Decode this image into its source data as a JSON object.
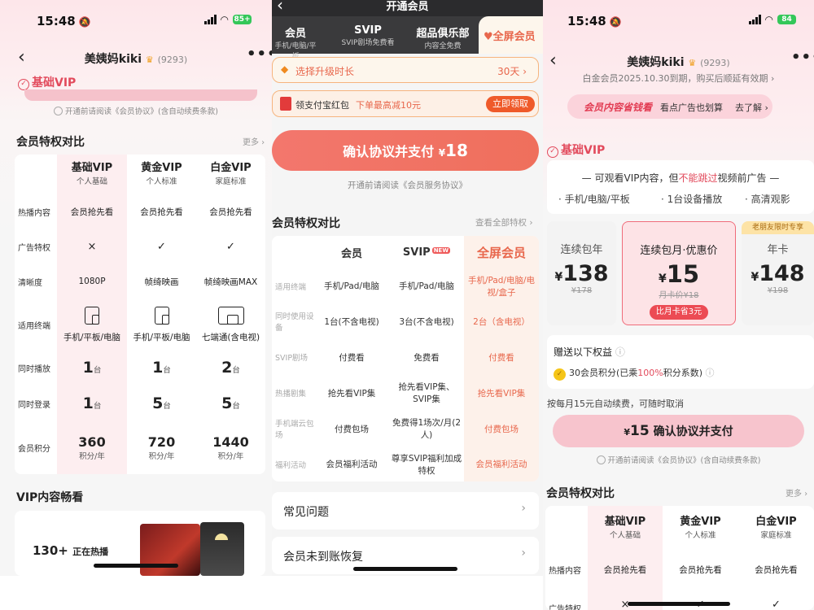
{
  "screen1": {
    "status": {
      "time": "15:48",
      "battery": "85+"
    },
    "header": {
      "title": "美姨妈kiki",
      "count": "(9293)"
    },
    "vip_badge": "基础VIP",
    "agreement": "开通前请阅读《会员协议》(含自动续费条款)",
    "compare": {
      "title": "会员特权对比",
      "more": "更多",
      "columns": [
        {
          "name": "基础VIP",
          "sub": "个人基础"
        },
        {
          "name": "黄金VIP",
          "sub": "个人标准"
        },
        {
          "name": "白金VIP",
          "sub": "家庭标准"
        }
      ],
      "labels": [
        "热播内容",
        "广告特权",
        "清晰度",
        "适用终端",
        "同时播放",
        "同时登录",
        "会员积分"
      ],
      "hot": [
        "会员抢先看",
        "会员抢先看",
        "会员抢先看"
      ],
      "ad": [
        "×",
        "✓",
        "✓"
      ],
      "clarity": [
        "1080P",
        "帧绮映画",
        "帧绮映画MAX"
      ],
      "terminal": [
        "手机/平板/电脑",
        "手机/平板/电脑",
        "七端通(含电视)"
      ],
      "play": [
        {
          "n": "1",
          "u": "台"
        },
        {
          "n": "1",
          "u": "台"
        },
        {
          "n": "2",
          "u": "台"
        }
      ],
      "login": [
        {
          "n": "1",
          "u": "台"
        },
        {
          "n": "5",
          "u": "台"
        },
        {
          "n": "5",
          "u": "台"
        }
      ],
      "points": [
        {
          "n": "360",
          "u": "积分/年"
        },
        {
          "n": "720",
          "u": "积分/年"
        },
        {
          "n": "1440",
          "u": "积分/年"
        }
      ]
    },
    "vip_content": {
      "title": "VIP内容畅看",
      "count": "130+",
      "count_label": "正在热播"
    }
  },
  "screen2": {
    "header_title": "开通会员",
    "tabs": [
      {
        "name": "会员",
        "desc": "手机/电脑/平板"
      },
      {
        "name": "SVIP",
        "desc": "SVIP剧场免费看"
      },
      {
        "name": "超品俱乐部",
        "desc": "内容全免费"
      },
      {
        "name": "全屏会员",
        "desc": ""
      }
    ],
    "duration": {
      "label": "选择升级时长",
      "value": "30天"
    },
    "redpack": {
      "label": "领支付宝红包",
      "highlight": "下单最高减10元",
      "button": "立即领取"
    },
    "pay_button": {
      "label": "确认协议并支付",
      "currency": "¥",
      "amount": "18"
    },
    "agreement": "开通前请阅读《会员服务协议》",
    "compare": {
      "title": "会员特权对比",
      "more": "查看全部特权",
      "columns": [
        "会员",
        "SVIP",
        "全屏会员"
      ],
      "new_badge": "NEW",
      "rows": [
        {
          "label": "适用终端",
          "vals": [
            "手机/Pad/电脑",
            "手机/Pad/电脑",
            "手机/Pad/电脑/电视/盒子"
          ]
        },
        {
          "label": "同时使用设备",
          "vals": [
            "1台(不含电视)",
            "3台(不含电视)",
            "2台（含电视）"
          ]
        },
        {
          "label": "SVIP剧场",
          "vals": [
            "付费看",
            "免费看",
            "付费看"
          ]
        },
        {
          "label": "热播剧集",
          "vals": [
            "抢先看VIP集",
            "抢先看VIP集、SVIP集",
            "抢先看VIP集"
          ]
        },
        {
          "label": "手机端云包场",
          "vals": [
            "付费包场",
            "免费得1场次/月(2人)",
            "付费包场"
          ]
        },
        {
          "label": "福利活动",
          "vals": [
            "会员福利活动",
            "尊享SVIP福利加成特权",
            "会员福利活动"
          ]
        }
      ]
    },
    "faq": "常见问题",
    "recover": "会员未到账恢复"
  },
  "screen3": {
    "status": {
      "time": "15:48",
      "battery": "84"
    },
    "header": {
      "title": "美姨妈kiki",
      "count": "(9293)",
      "expiry": "白金会员2025.10.30到期，购买后顺延有效期"
    },
    "banner": {
      "tag": "会员内容省钱看",
      "text": "看点广告也划算",
      "link": "去了解"
    },
    "vip_badge": "基础VIP",
    "info": {
      "line1a": "可观看VIP内容，但",
      "line1b": "不能跳过",
      "line1c": "视频前广告",
      "features": [
        "手机/电脑/平板",
        "1台设备播放",
        "高清观影"
      ]
    },
    "prices": [
      {
        "name": "连续包年",
        "currency": "¥",
        "price": "138",
        "orig": "¥178"
      },
      {
        "name": "连续包月·优惠价",
        "currency": "¥",
        "price": "15",
        "orig": "月卡价¥18",
        "tag": "比月卡省3元"
      },
      {
        "name": "年卡",
        "currency": "¥",
        "price": "148",
        "orig": "¥198",
        "badge": "老朋友限时专享"
      }
    ],
    "gift": {
      "title": "赠送以下权益",
      "item_pre": "30会员积分(已乘",
      "item_pct": "100%",
      "item_post": "积分系数)"
    },
    "renew_note": "按每月15元自动续费，可随时取消",
    "pay_button": {
      "currency": "¥",
      "amount": "15",
      "label": "确认协议并支付"
    },
    "agreement": "开通前请阅读《会员协议》(含自动续费条款)",
    "compare": {
      "title": "会员特权对比",
      "more": "更多",
      "columns": [
        {
          "name": "基础VIP",
          "sub": "个人基础"
        },
        {
          "name": "黄金VIP",
          "sub": "个人标准"
        },
        {
          "name": "白金VIP",
          "sub": "家庭标准"
        }
      ],
      "labels": [
        "热播内容",
        "广告特权"
      ],
      "hot": [
        "会员抢先看",
        "会员抢先看",
        "会员抢先看"
      ],
      "ad": [
        "×",
        "✓",
        "✓"
      ]
    }
  },
  "colors": {
    "accent": "#e24a5c",
    "orange": "#ef6f5c",
    "gold": "#f0a020"
  }
}
